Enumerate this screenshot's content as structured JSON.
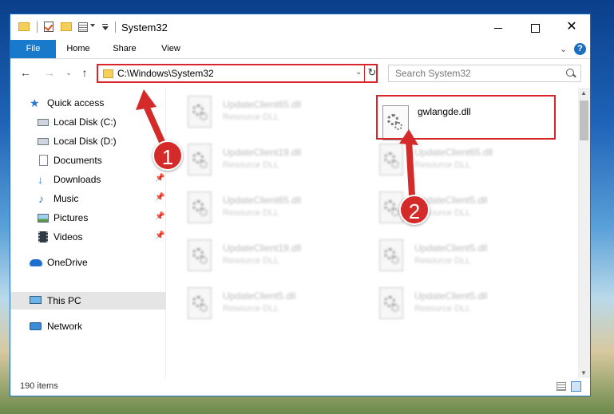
{
  "window": {
    "title": "System32",
    "close_glyph": "✕"
  },
  "ribbon": {
    "tabs": [
      {
        "label": "File"
      },
      {
        "label": "Home"
      },
      {
        "label": "Share"
      },
      {
        "label": "View"
      }
    ],
    "help_glyph": "?"
  },
  "navigation": {
    "address": "C:\\Windows\\System32",
    "search_placeholder": "Search System32"
  },
  "sidebar": {
    "items": [
      {
        "label": "Quick access",
        "icon": "star-icon"
      },
      {
        "label": "Local Disk (C:)",
        "icon": "disk-icon"
      },
      {
        "label": "Local Disk (D:)",
        "icon": "disk-icon"
      },
      {
        "label": "Documents",
        "icon": "document-icon",
        "pinned": true
      },
      {
        "label": "Downloads",
        "icon": "download-icon",
        "pinned": true
      },
      {
        "label": "Music",
        "icon": "music-icon",
        "pinned": true
      },
      {
        "label": "Pictures",
        "icon": "picture-icon",
        "pinned": true
      },
      {
        "label": "Videos",
        "icon": "video-icon",
        "pinned": true
      },
      {
        "label": "OneDrive",
        "icon": "cloud-icon"
      },
      {
        "label": "This PC",
        "icon": "computer-icon",
        "selected": true
      },
      {
        "label": "Network",
        "icon": "network-icon"
      }
    ]
  },
  "files": {
    "left_column": [
      {
        "name": "UpdateClient65.dll",
        "type": "Resource DLL"
      },
      {
        "name": "UpdateClient19.dll",
        "type": "Resource DLL"
      },
      {
        "name": "UpdateClient65.dll",
        "type": "Resource DLL"
      },
      {
        "name": "UpdateClient19.dll",
        "type": "Resource DLL"
      },
      {
        "name": "UpdateClient5.dll",
        "type": "Resource DLL"
      }
    ],
    "right_column": [
      {
        "name": "gwlangde.dll",
        "type": ""
      },
      {
        "name": "UpdateClient65.dll",
        "type": "Resource DLL"
      },
      {
        "name": "UpdateClient5.dll",
        "type": "Resource DLL"
      },
      {
        "name": "UpdateClient5.dll",
        "type": "Resource DLL"
      },
      {
        "name": "UpdateClient5.dll",
        "type": "Resource DLL"
      }
    ]
  },
  "status": {
    "item_count": "190 items"
  },
  "annotations": {
    "step1": "1",
    "step2": "2",
    "highlight_color": "#d9242a",
    "badge_color": "#d42a2a"
  }
}
